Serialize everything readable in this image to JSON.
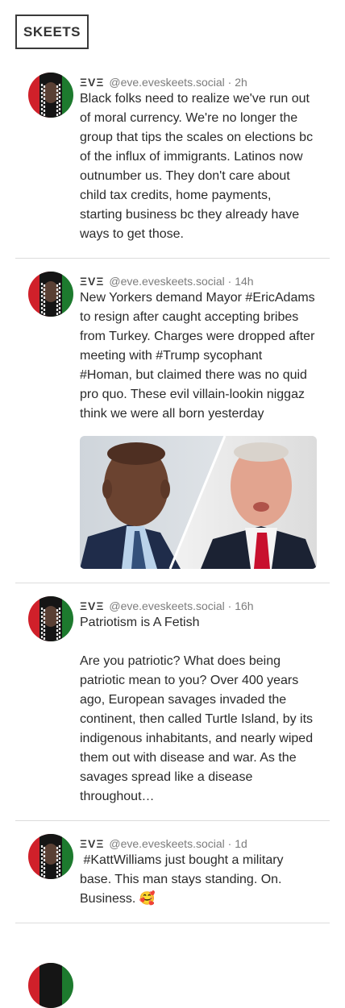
{
  "header": {
    "title": "SKEETS"
  },
  "posts": [
    {
      "author": "ΞVΞ",
      "handle": "@eve.eveskeets.social",
      "time": "· 2h",
      "text": "Black folks need to realize we've run out of moral currency. We're no longer the group that tips the scales on elections bc of the influx of immigrants. Latinos now outnumber us. They don't care about child tax credits, home payments, starting business bc they already have ways to get those."
    },
    {
      "author": "ΞVΞ",
      "handle": "@eve.eveskeets.social",
      "time": "· 14h",
      "text": "New Yorkers demand Mayor #EricAdams to resign after caught accepting bribes from Turkey. Charges were dropped after meeting with #Trump sycophant  #Homan, but claimed there was no quid pro quo. These evil villain-lookin niggaz think we were all born yesterday"
    },
    {
      "author": "ΞVΞ",
      "handle": "@eve.eveskeets.social",
      "time": "· 16h",
      "text": "Patriotism is A Fetish\n\nAre you patriotic? What does being patriotic mean to you? Over 400 years ago, European savages invaded the continent, then called Turtle Island, by its indigenous inhabitants, and nearly wiped them out with disease and war. As the savages spread like a disease throughout…"
    },
    {
      "author": "ΞVΞ",
      "handle": "@eve.eveskeets.social",
      "time": "· 1d",
      "text": " #KattWilliams just bought a military base. This man stays standing. On. Business. 🥰"
    }
  ],
  "colors": {
    "avatar_red": "#d0202a",
    "avatar_green": "#1d7a2e",
    "avatar_black": "#151515",
    "divider": "#dcdcdc"
  }
}
